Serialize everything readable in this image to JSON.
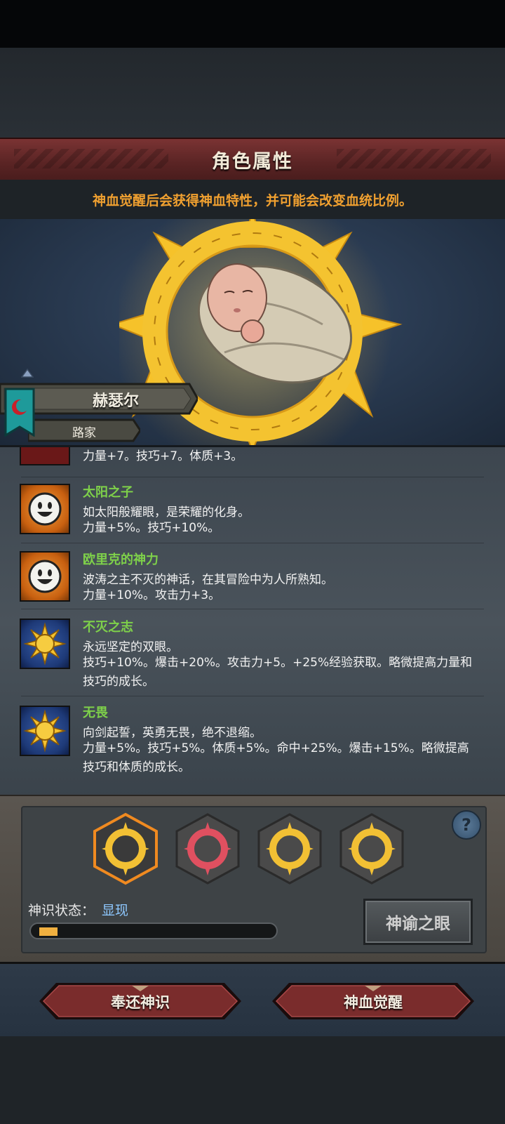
{
  "header": {
    "title": "角色属性",
    "subtitle": "神血觉醒后会获得神血特性，并可能会改变血统比例。"
  },
  "character": {
    "name": "赫瑟尔",
    "house": "路家"
  },
  "traits": [
    {
      "name": "",
      "desc": "",
      "stats": "力量+7。技巧+7。体质+3。",
      "icon": "red-crest-icon"
    },
    {
      "name": "太阳之子",
      "desc": "如太阳般耀眼，是荣耀的化身。",
      "stats": "力量+5%。技巧+10%。",
      "icon": "smiley-face-icon"
    },
    {
      "name": "欧里克的神力",
      "desc": "波涛之主不灭的神话，在其冒险中为人所熟知。",
      "stats": "力量+10%。攻击力+3。",
      "icon": "smiley-face-icon"
    },
    {
      "name": "不灭之志",
      "desc": "永远坚定的双眼。",
      "stats": "技巧+10%。爆击+20%。攻击力+5。+25%经验获取。略微提高力量和技巧的成长。",
      "icon": "golden-sun-icon"
    },
    {
      "name": "无畏",
      "desc": "向剑起誓，英勇无畏，绝不退缩。",
      "stats": "力量+5%。技巧+5%。体质+5%。命中+25%。爆击+15%。略微提高技巧和体质的成长。",
      "icon": "golden-sun-icon"
    }
  ],
  "divine": {
    "status_label": "神识状态：",
    "status_value": "显现",
    "progress": 0.08,
    "oracle_button": "神谕之眼",
    "help": "?"
  },
  "actions": {
    "return_label": "奉还神识",
    "awaken_label": "神血觉醒"
  },
  "colors": {
    "trait_name": "#7ed04a",
    "subtitle": "#f0a030",
    "status_value": "#8ec8ff",
    "banner": "#6a2a2a"
  }
}
